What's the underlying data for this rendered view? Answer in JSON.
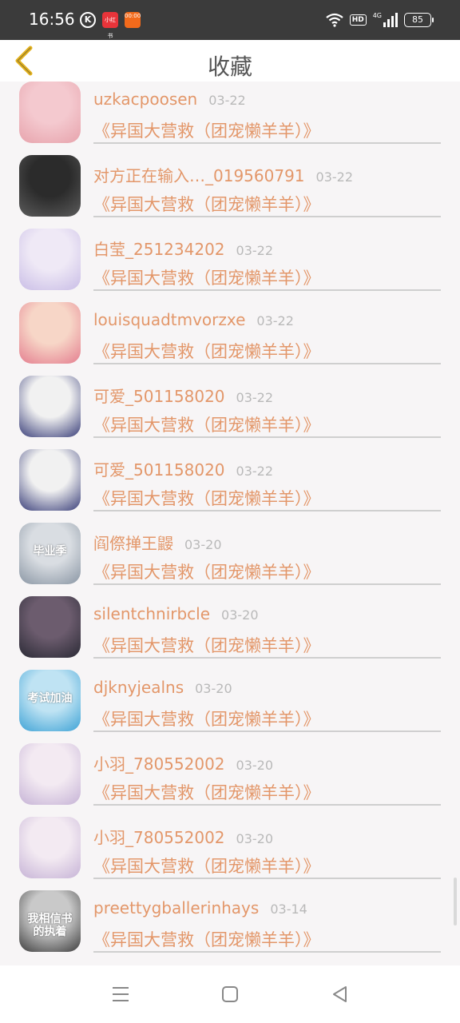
{
  "status_bar": {
    "time": "16:56",
    "badges": [
      "K",
      "小红书",
      "00:00"
    ],
    "hd_label": "HD",
    "network_label": "4G",
    "battery": "85"
  },
  "header": {
    "title": "收藏",
    "back_icon": "chevron-left-icon"
  },
  "favorites": [
    {
      "name": "uzkacpoosen",
      "date": "03-22",
      "book": "《异国大营救（团宠懒羊羊）》",
      "avatar_colors": [
        "#f4c9cf",
        "#e7a3ac"
      ]
    },
    {
      "name": "对方正在输入…_019560791",
      "date": "03-22",
      "book": "《异国大营救（团宠懒羊羊）》",
      "avatar_colors": [
        "#2b2b2b",
        "#5c5c5c"
      ]
    },
    {
      "name": "白莹_251234202",
      "date": "03-22",
      "book": "《异国大营救（团宠懒羊羊）》",
      "avatar_colors": [
        "#efe9f6",
        "#c9bde6"
      ]
    },
    {
      "name": "louisquadtmvorzxe",
      "date": "03-22",
      "book": "《异国大营救（团宠懒羊羊）》",
      "avatar_colors": [
        "#f7d6c7",
        "#e47e8f"
      ]
    },
    {
      "name": "可爱_501158020",
      "date": "03-22",
      "book": "《异国大营救（团宠懒羊羊）》",
      "avatar_colors": [
        "#f1f1f1",
        "#3a3f7a"
      ]
    },
    {
      "name": "可爱_501158020",
      "date": "03-22",
      "book": "《异国大营救（团宠懒羊羊）》",
      "avatar_colors": [
        "#f1f1f1",
        "#3a3f7a"
      ]
    },
    {
      "name": "阎傺掸王鼹",
      "date": "03-20",
      "book": "《异国大营救（团宠懒羊羊）》",
      "avatar_colors": [
        "#d9dde2",
        "#8a96a4"
      ],
      "avatar_text": "毕业季"
    },
    {
      "name": "silentchnirbcle",
      "date": "03-20",
      "book": "《异国大营救（团宠懒羊羊）》",
      "avatar_colors": [
        "#6c5c6e",
        "#2a2a35"
      ]
    },
    {
      "name": "djknyjealns",
      "date": "03-20",
      "book": "《异国大营救（团宠懒羊羊）》",
      "avatar_colors": [
        "#bfe3f3",
        "#3fa3d6"
      ],
      "avatar_text": "考试加油"
    },
    {
      "name": "小羽_780552002",
      "date": "03-20",
      "book": "《异国大营救（团宠懒羊羊）》",
      "avatar_colors": [
        "#f3eaf2",
        "#c6b3d6"
      ]
    },
    {
      "name": "小羽_780552002",
      "date": "03-20",
      "book": "《异国大营救（团宠懒羊羊）》",
      "avatar_colors": [
        "#f3eaf2",
        "#c6b3d6"
      ]
    },
    {
      "name": "preettygballerinhays",
      "date": "03-14",
      "book": "《异国大营救（团宠懒羊羊）》",
      "avatar_colors": [
        "#c9c9c9",
        "#3e3e3e"
      ],
      "avatar_text": "我相信书 的执着"
    }
  ],
  "nav": {
    "menu_icon": "menu-lines-icon",
    "home_icon": "home-square-icon",
    "back_icon": "back-triangle-icon"
  },
  "colors": {
    "accent": "#e3976a",
    "date": "#b9b9b9",
    "back_chevron": "#e3b21e",
    "status_bar": "#3b3b3b"
  }
}
